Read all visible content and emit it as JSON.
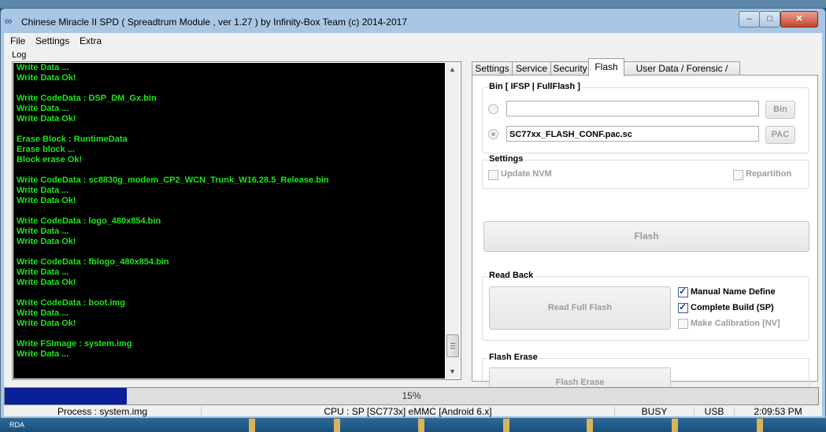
{
  "window": {
    "title": "Chinese Miracle II SPD ( Spreadtrum Module , ver 1.27 ) by Infinity-Box Team (c) 2014-2017",
    "minimize": "–",
    "maximize": "□",
    "close": "✕"
  },
  "menu": [
    "File",
    "Settings",
    "Extra"
  ],
  "log": {
    "label": "Log",
    "lines": [
      "Write Data ...",
      "Write Data Ok!",
      "",
      "Write CodeData : DSP_DM_Gx.bin",
      "Write Data ...",
      "Write Data Ok!",
      "",
      "Erase Block : RuntimeData",
      "Erase block ...",
      "Block erase Ok!",
      "",
      "Write CodeData : sc8830g_modem_CP2_WCN_Trunk_W16.28.5_Release.bin",
      "Write Data ...",
      "Write Data Ok!",
      "",
      "Write CodeData : logo_480x854.bin",
      "Write Data ...",
      "Write Data Ok!",
      "",
      "Write CodeData : fblogo_480x854.bin",
      "Write Data ...",
      "Write Data Ok!",
      "",
      "Write CodeData : boot.img",
      "Write Data ...",
      "Write Data Ok!",
      "",
      "Write FSImage : system.img",
      "Write Data ..."
    ],
    "text_color": "#19e619"
  },
  "tabs": [
    "Settings",
    "Service",
    "Security",
    "Flash",
    "User Data / Forensic / Other"
  ],
  "active_tab": "Flash",
  "flash": {
    "bin_group": "Bin  [ IFSP | FullFlash ]",
    "bin_path": "",
    "bin_button": "Bin",
    "pac_path": "SC77xx_FLASH_CONF.pac.sc",
    "pac_button": "PAC",
    "settings_group": "Settings",
    "update_nvm": "Update NVM",
    "repartition": "Repartition",
    "flash_button": "Flash",
    "readback_group": "Read Back",
    "read_full_flash": "Read Full Flash",
    "manual_name_define": "Manual Name Define",
    "complete_build": "Complete Build (SP)",
    "make_calibration": "Make Calibration [NV]",
    "flash_erase_group": "Flash Erase",
    "flash_erase_button": "Flash Erase"
  },
  "progress": {
    "value": 0.15,
    "label": "15%",
    "color": "#0a1f9a"
  },
  "status": {
    "process": "Process : system.img",
    "cpu": "CPU : SP [SC773x] eMMC [Android 6.x]",
    "state": "BUSY",
    "connection": "USB",
    "time": "2:09:53 PM"
  },
  "taskbar": {
    "label": "RDA"
  }
}
